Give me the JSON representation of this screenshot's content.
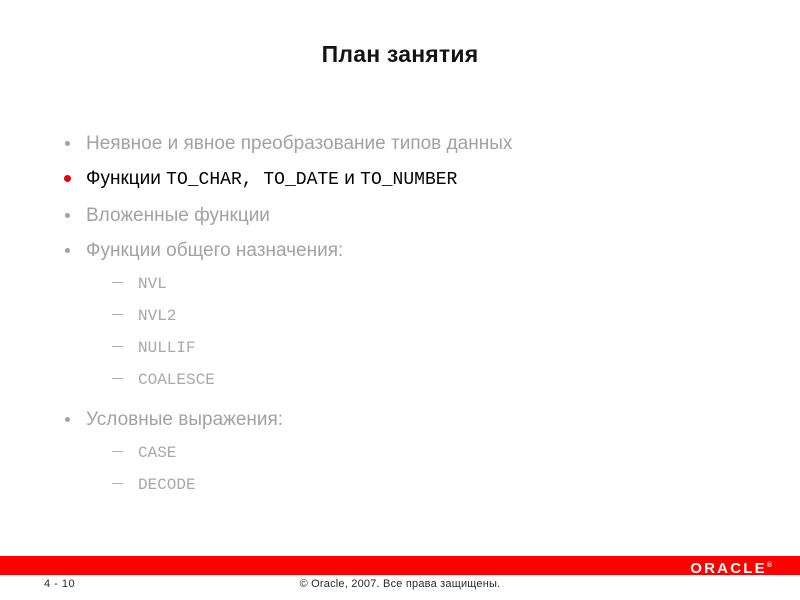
{
  "slide": {
    "title": "План занятия",
    "agenda": [
      {
        "label": "Неявное и явное преобразование типов данных",
        "active": false,
        "bullet": "dot-bullet-icon",
        "subitems": []
      },
      {
        "label": "Функции TO_CHAR, TO_DATE и TO_NUMBER",
        "label_prefix": "Функции ",
        "label_mono": "TO_CHAR, TO_DATE",
        "label_mid": " и ",
        "label_mono2": "TO_NUMBER",
        "active": true,
        "bullet": "dot-bullet-icon",
        "subitems": []
      },
      {
        "label": "Вложенные функции",
        "active": false,
        "bullet": "dot-bullet-icon",
        "subitems": []
      },
      {
        "label": "Функции общего назначения:",
        "active": false,
        "bullet": "dot-bullet-icon",
        "subitems": [
          "NVL",
          "NVL2",
          "NULLIF",
          "COALESCE"
        ]
      },
      {
        "label": "Условные выражения:",
        "active": false,
        "bullet": "dot-bullet-icon",
        "subitems": [
          "CASE",
          "DECODE"
        ]
      }
    ]
  },
  "footer": {
    "page_number": "4 - 10",
    "copyright": "© Oracle, 2007. Все права защищены.",
    "logo_text": "ORACLE",
    "logo_tm": "®",
    "bar_color": "#ff0000"
  },
  "colors": {
    "accent_red": "#e60000",
    "bar_red": "#ff0000",
    "dimmed_text": "#a2a2a2",
    "active_text": "#000000",
    "title_text": "#141414",
    "background": "#ffffff"
  }
}
